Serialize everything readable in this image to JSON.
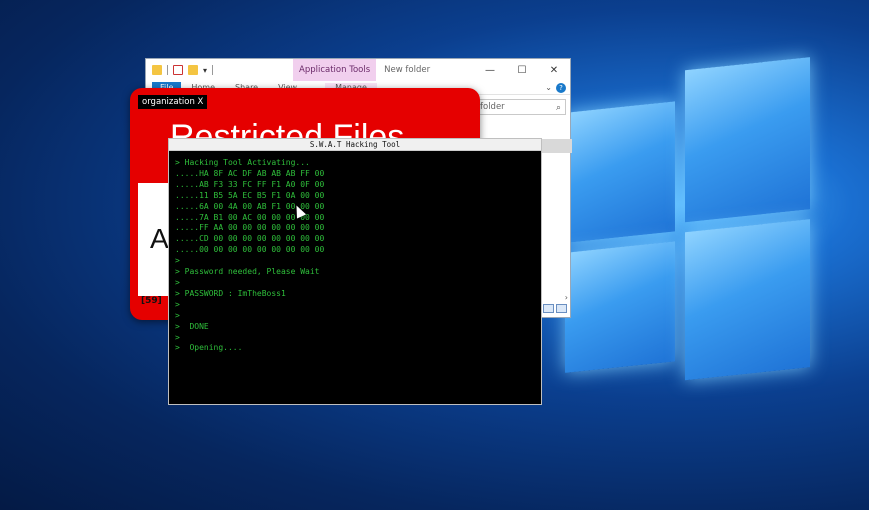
{
  "explorer": {
    "application_tools": "Application Tools",
    "title": "New folder",
    "minimize": "—",
    "maximize": "☐",
    "close": "✕",
    "ribbon_tabs": [
      "File",
      "Home",
      "Share",
      "View"
    ],
    "manage_tab": "Manage",
    "search_placeholder": "folder",
    "help": "?",
    "chevron": "⌄",
    "scroll_arrow": "›"
  },
  "restricted": {
    "org_label": "organization X",
    "title": "Restricted Files",
    "body_letter": "A",
    "counter": "[59]"
  },
  "console": {
    "title": "S.W.A.T Hacking Tool",
    "lines": [
      "> Hacking Tool Activating...",
      ".....HA 8F AC DF AB AB AB FF 00",
      ".....AB F3 33 FC FF F1 A0 0F 00",
      ".....11 B5 5A EC B5 F1 0A 00 00",
      ".....6A 00 4A 00 AB F1 00 00 00",
      ".....7A B1 00 AC 00 00 00 00 00",
      ".....FF AA 00 00 00 00 00 00 00",
      ".....CD 00 00 00 00 00 00 00 00",
      ".....00 00 00 00 00 00 00 00 00",
      ">",
      "> Password needed, Please Wait",
      ">",
      "> PASSWORD : ImTheBoss1",
      ">",
      ">",
      ">  DONE",
      ">",
      ">  Opening...."
    ]
  },
  "colors": {
    "console_text": "#2fbf3b",
    "restricted_red": "#e50000",
    "desktop_blue": "#0b3f8f"
  }
}
